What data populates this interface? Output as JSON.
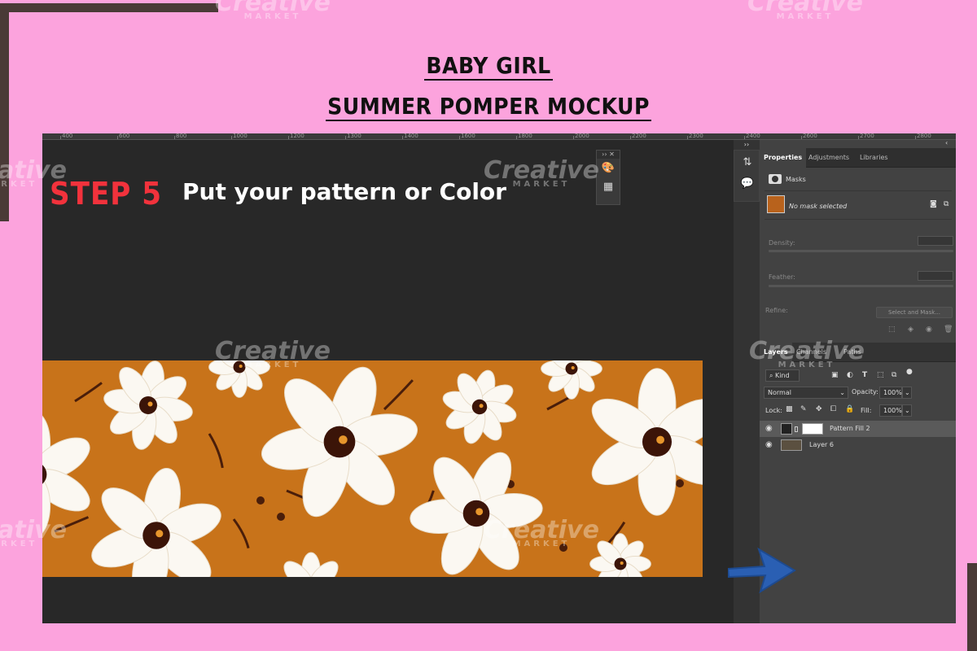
{
  "header": {
    "line1": "BABY GIRL",
    "line2": "SUMMER POMPER MOCKUP"
  },
  "step": {
    "label": "STEP 5",
    "instruction": "Put your pattern or Color"
  },
  "ruler": {
    "ticks": [
      "400",
      "600",
      "800",
      "1000",
      "1200",
      "1300",
      "1400",
      "1600",
      "1800",
      "2000",
      "2200",
      "2300",
      "2400",
      "2600",
      "2700",
      "2800"
    ]
  },
  "properties_panel": {
    "tabs": [
      "Properties",
      "Adjustments",
      "Libraries"
    ],
    "masks_label": "Masks",
    "no_mask": "No mask selected",
    "density_label": "Density:",
    "feather_label": "Feather:",
    "refine_label": "Refine:",
    "select_mask_button": "Select and Mask..."
  },
  "layers_panel": {
    "tabs": [
      "Layers",
      "Channels",
      "Paths"
    ],
    "kind_filter": "Kind",
    "blend_mode": "Normal",
    "opacity_label": "Opacity:",
    "opacity_value": "100%",
    "lock_label": "Lock:",
    "fill_label": "Fill:",
    "fill_value": "100%",
    "layers": [
      {
        "name": "Pattern Fill 2",
        "selected": true
      },
      {
        "name": "Layer 6",
        "selected": false
      }
    ]
  },
  "watermark": {
    "word": "Creative",
    "sub": "MARKET"
  },
  "colors": {
    "background": "#fca3dd",
    "pattern_base": "#c8731a",
    "step_red": "#f2323c",
    "arrow_blue": "#2a5fb3"
  }
}
